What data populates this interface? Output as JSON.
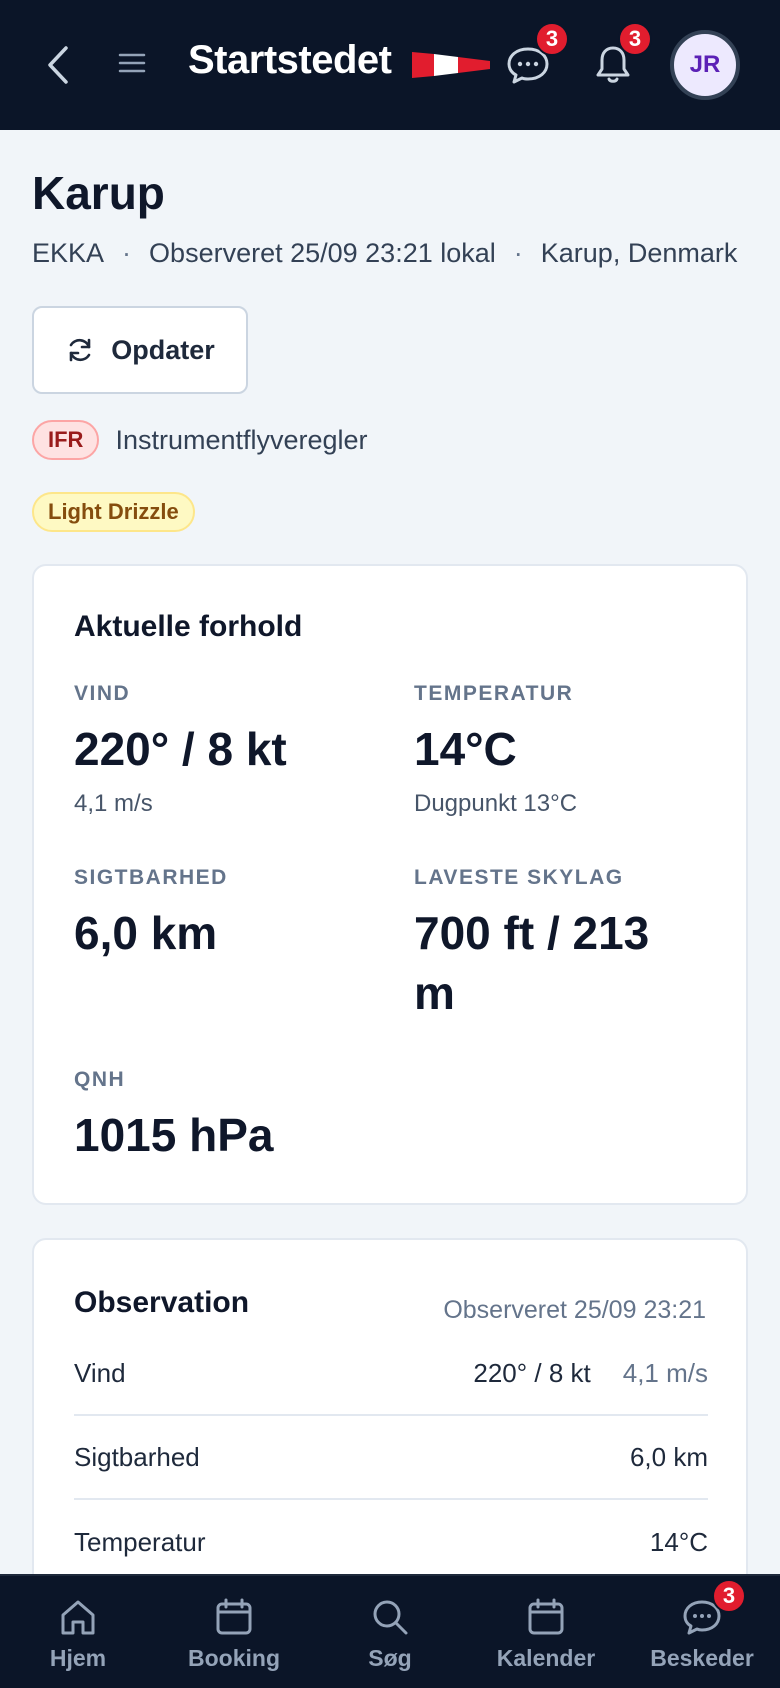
{
  "header": {
    "title": "Startstedet",
    "chat_badge": "3",
    "notifications_badge": "3",
    "avatar_initials": "JR"
  },
  "station": {
    "name": "Karup",
    "code": "EKKA",
    "observed": "Observeret 25/09 23:21 lokal",
    "location": "Karup, Denmark",
    "separator": "·"
  },
  "actions": {
    "refresh_label": "Opdater"
  },
  "flight_rules": {
    "code": "IFR",
    "description": "Instrumentflyveregler",
    "color": "#991b1b"
  },
  "weather_tag": "Light Drizzle",
  "current": {
    "heading": "Aktuelle forhold",
    "wind": {
      "label": "VIND",
      "value": "220° / 8 kt",
      "sub": "4,1 m/s"
    },
    "temperature": {
      "label": "TEMPERATUR",
      "value": "14°C",
      "sub": "Dugpunkt 13°C"
    },
    "visibility": {
      "label": "SIGTBARHED",
      "value": "6,0 km"
    },
    "ceiling": {
      "label": "LAVESTE SKYLAG",
      "value": "700 ft / 213 m"
    },
    "qnh": {
      "label": "QNH",
      "value": "1015 hPa"
    }
  },
  "observation": {
    "heading": "Observation",
    "time": "Observeret 25/09 23:21",
    "rows": [
      {
        "label": "Vind",
        "value": "220° / 8 kt",
        "secondary": "4,1 m/s"
      },
      {
        "label": "Sigtbarhed",
        "value": "6,0 km"
      },
      {
        "label": "Temperatur",
        "value": "14°C"
      }
    ]
  },
  "nav": {
    "items": [
      {
        "label": "Hjem",
        "icon": "home-icon"
      },
      {
        "label": "Booking",
        "icon": "calendar-icon"
      },
      {
        "label": "Søg",
        "icon": "search-icon"
      },
      {
        "label": "Kalender",
        "icon": "calendar-icon"
      },
      {
        "label": "Beskeder",
        "icon": "chat-icon"
      }
    ],
    "messages_badge": "3"
  },
  "colors": {
    "header_bg": "#0b1528",
    "badge": "#e11d2e",
    "avatar_text": "#5b21b6"
  }
}
